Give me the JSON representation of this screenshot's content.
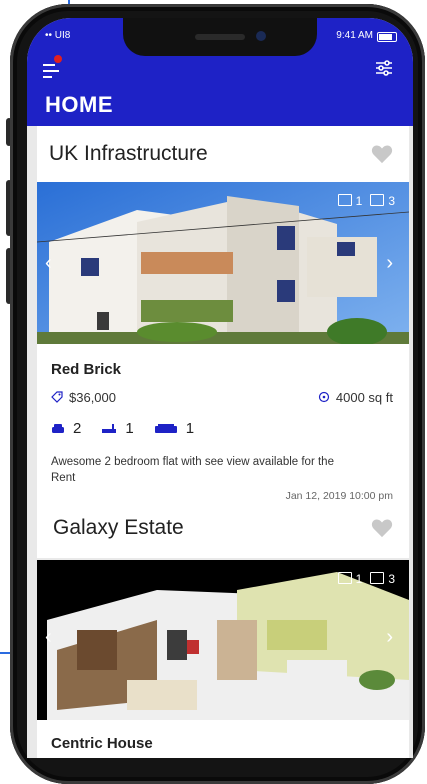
{
  "status": {
    "carrier": "•• UI8",
    "time": "9:41 AM"
  },
  "header": {
    "title": "HOME"
  },
  "colors": {
    "header": "#1e22c6",
    "accent": "#1e22c6",
    "heart": "#c8c8c8"
  },
  "listings": [
    {
      "section_title": "UK Infrastructure",
      "images_count": "1",
      "gallery_count": "3",
      "name": "Red Brick",
      "price": "$36,000",
      "area": "4000 sq ft",
      "beds": "2",
      "baths": "1",
      "sofas": "1",
      "description": "Awesome 2 bedroom flat with see view available for the Rent",
      "date": "Jan 12, 2019 10:00 pm"
    },
    {
      "section_title": "Galaxy Estate",
      "images_count": "1",
      "gallery_count": "3",
      "name": "Centric House"
    }
  ]
}
